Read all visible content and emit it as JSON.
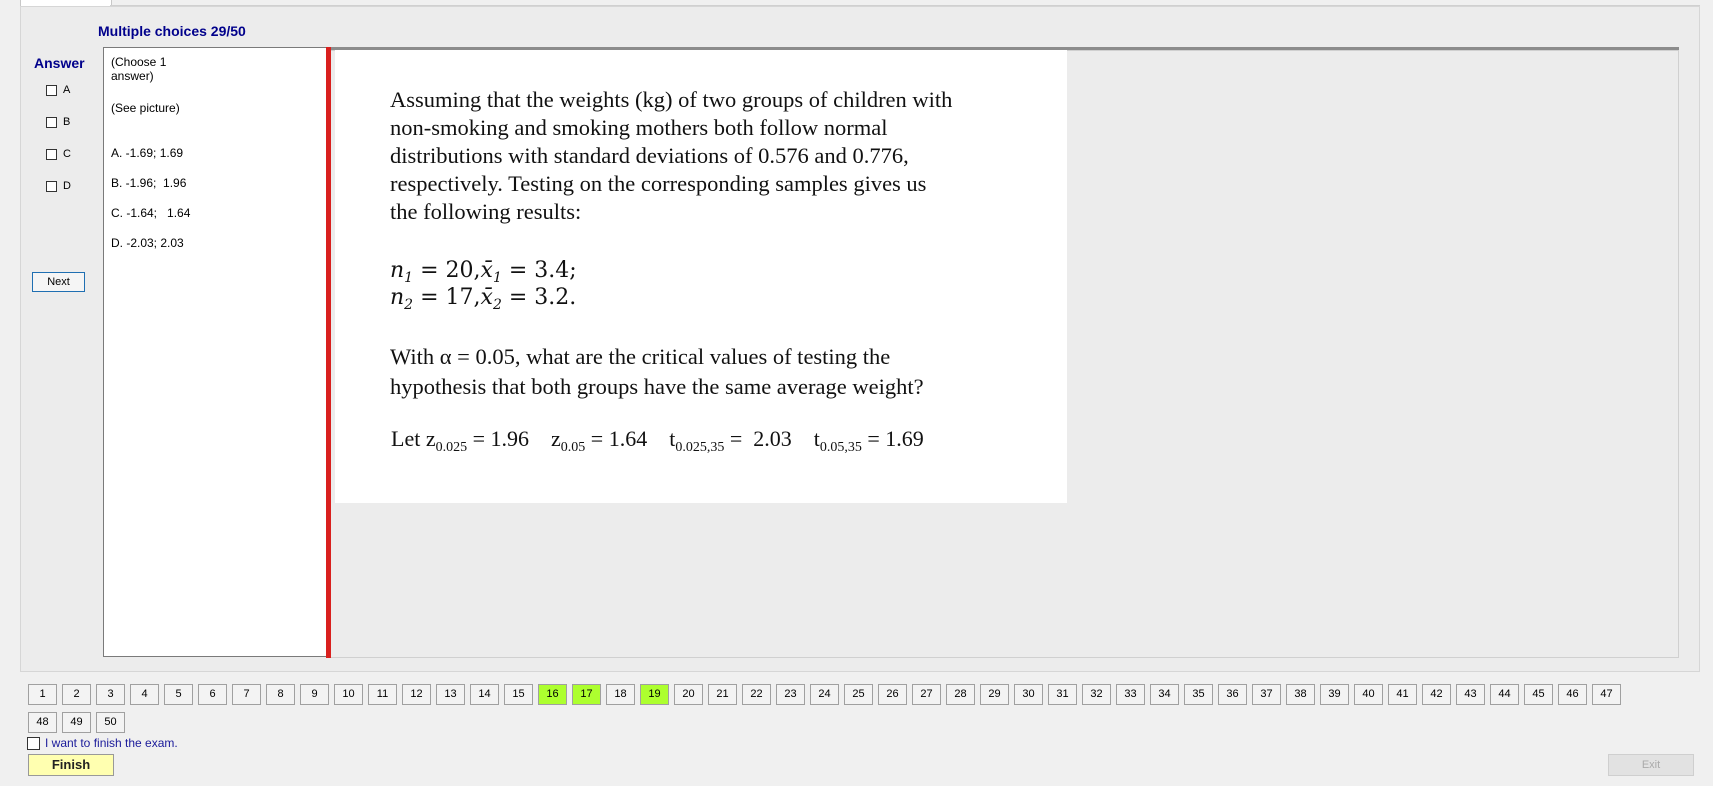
{
  "header": {
    "title": "Multiple choices 29/50"
  },
  "answer_panel": {
    "label": "Answer",
    "options": [
      {
        "label": "A",
        "checked": false
      },
      {
        "label": "B",
        "checked": false
      },
      {
        "label": "C",
        "checked": false
      },
      {
        "label": "D",
        "checked": false
      }
    ],
    "next_label": "Next"
  },
  "question_text_panel": {
    "instruction": "(Choose 1 answer)",
    "see_picture": "(See picture)",
    "choices": [
      "A. -1.69; 1.69",
      "B. -1.96;  1.96",
      "C. -1.64;   1.64",
      "D. -2.03; 2.03"
    ]
  },
  "question_image": {
    "paragraph_lines": [
      "Assuming that the weights (kg) of two groups of children with",
      "non-smoking and smoking mothers both follow normal",
      "distributions with standard deviations of 0.576 and 0.776,",
      "respectively.  Testing on the corresponding samples gives us",
      "the following results:"
    ],
    "sample1": {
      "n": "n",
      "n_sub": "1",
      "n_val": "= 20,",
      "x": "x̄",
      "x_sub": "1",
      "x_val": "= 3.4;"
    },
    "sample2": {
      "n": "n",
      "n_sub": "2",
      "n_val": "= 17,",
      "x": "x̄",
      "x_sub": "2",
      "x_val": "= 3.2."
    },
    "question_lines": [
      "With α = 0.05, what are the critical values of testing the",
      "hypothesis that both groups have the same average weight?"
    ],
    "let": {
      "prefix": "Let z",
      "z1_sub": "0.025",
      "z1_val": " = 1.96    ",
      "z2": "z",
      "z2_sub": "0.05",
      "z2_val": " = 1.64    ",
      "t1": "t",
      "t1_sub": "0.025,35",
      "t1_val": " =  2.03    ",
      "t2": "t",
      "t2_sub": "0.05,35",
      "t2_val": " = 1.69"
    }
  },
  "navigation": {
    "questions": [
      "1",
      "2",
      "3",
      "4",
      "5",
      "6",
      "7",
      "8",
      "9",
      "10",
      "11",
      "12",
      "13",
      "14",
      "15",
      "16",
      "17",
      "18",
      "19",
      "20",
      "21",
      "22",
      "23",
      "24",
      "25",
      "26",
      "27",
      "28",
      "29",
      "30",
      "31",
      "32",
      "33",
      "34",
      "35",
      "36",
      "37",
      "38",
      "39",
      "40",
      "41",
      "42",
      "43",
      "44",
      "45",
      "46",
      "47",
      "48",
      "49",
      "50"
    ],
    "answered": [
      "16",
      "17",
      "19"
    ]
  },
  "footer": {
    "finish_checkbox_label": "I want to finish the exam.",
    "finish_label": "Finish",
    "exit_label": "Exit"
  },
  "colors": {
    "title_blue": "#00008b",
    "answered_green": "#adff2f",
    "divider_red": "#d9201e",
    "finish_yellow": "#ffffb0"
  }
}
